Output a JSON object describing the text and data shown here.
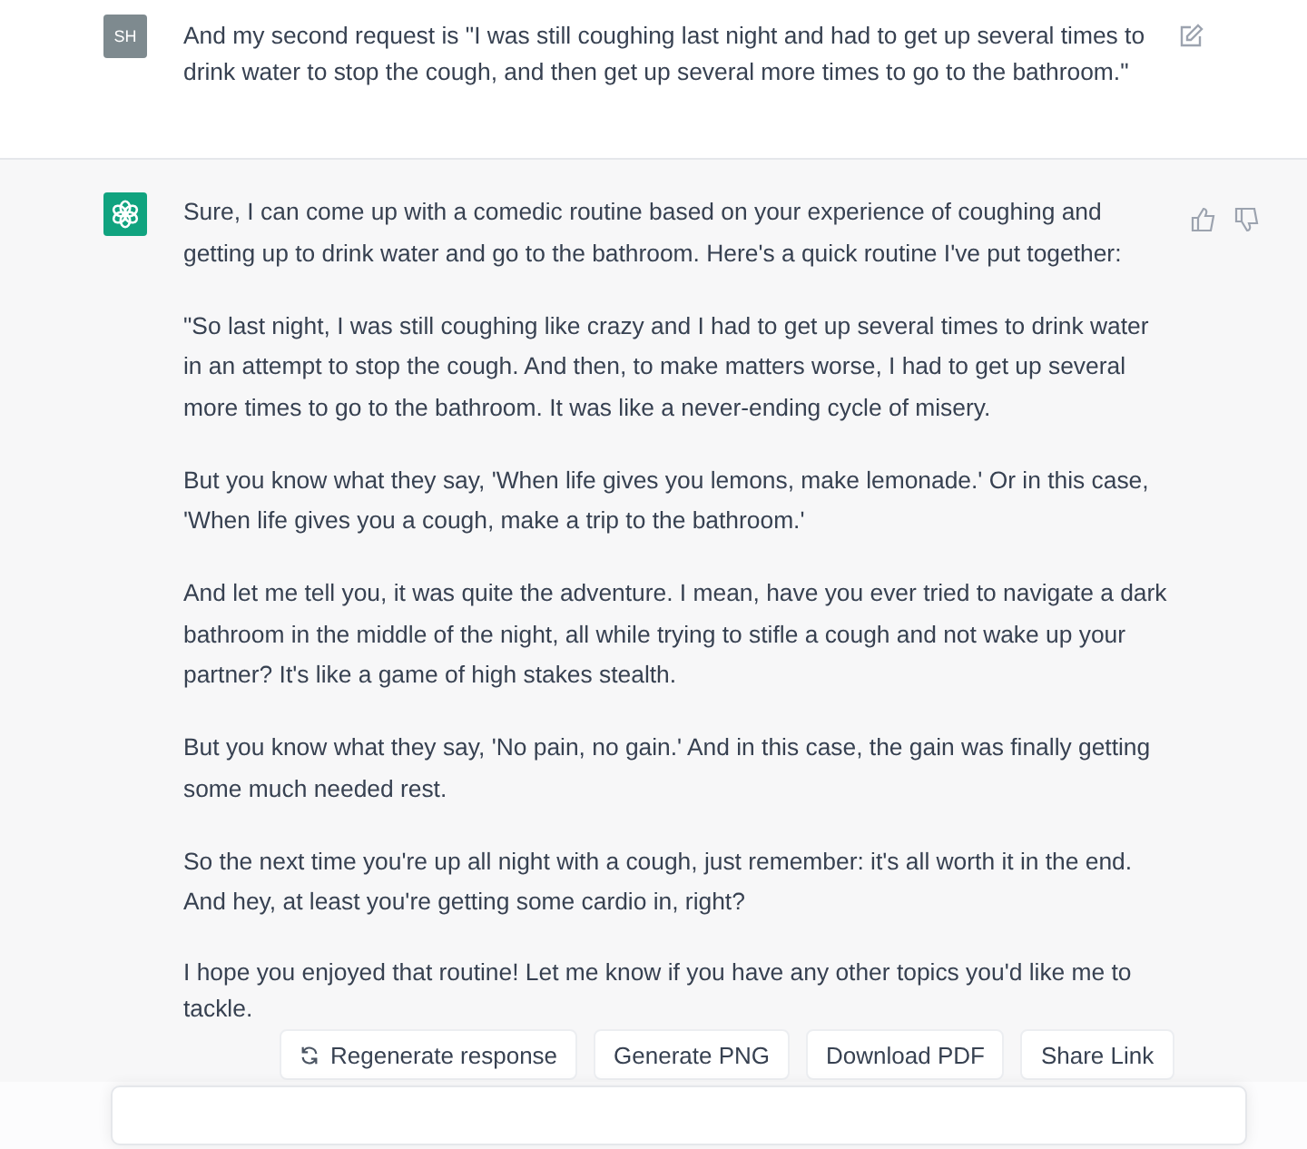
{
  "user_message": {
    "avatar": "SH",
    "text": "And my second request is \"I was still coughing last night and had to get up several times to drink water to stop the cough, and then get up several more times to go to the bathroom.\""
  },
  "assistant_message": {
    "paragraphs": [
      "Sure, I can come up with a comedic routine based on your experience of coughing and getting up to drink water and go to the bathroom. Here's a quick routine I've put together:",
      "\"So last night, I was still coughing like crazy and I had to get up several times to drink water in an attempt to stop the cough. And then, to make matters worse, I had to get up several more times to go to the bathroom. It was like a never-ending cycle of misery.",
      "But you know what they say, 'When life gives you lemons, make lemonade.' Or in this case, 'When life gives you a cough, make a trip to the bathroom.'",
      "And let me tell you, it was quite the adventure. I mean, have you ever tried to navigate a dark bathroom in the middle of the night, all while trying to stifle a cough and not wake up your partner? It's like a game of high stakes stealth.",
      "But you know what they say, 'No pain, no gain.' And in this case, the gain was finally getting some much needed rest.",
      "So the next time you're up all night with a cough, just remember: it's all worth it in the end. And hey, at least you're getting some cardio in, right?",
      "I hope you enjoyed that routine! Let me know if you have any other topics you'd like me to tackle."
    ]
  },
  "actions": [
    {
      "kind": "regenerate",
      "label": "Regenerate response"
    },
    {
      "kind": "plain",
      "label": "Generate PNG"
    },
    {
      "kind": "plain",
      "label": "Download PDF"
    },
    {
      "kind": "plain",
      "label": "Share Link"
    }
  ]
}
